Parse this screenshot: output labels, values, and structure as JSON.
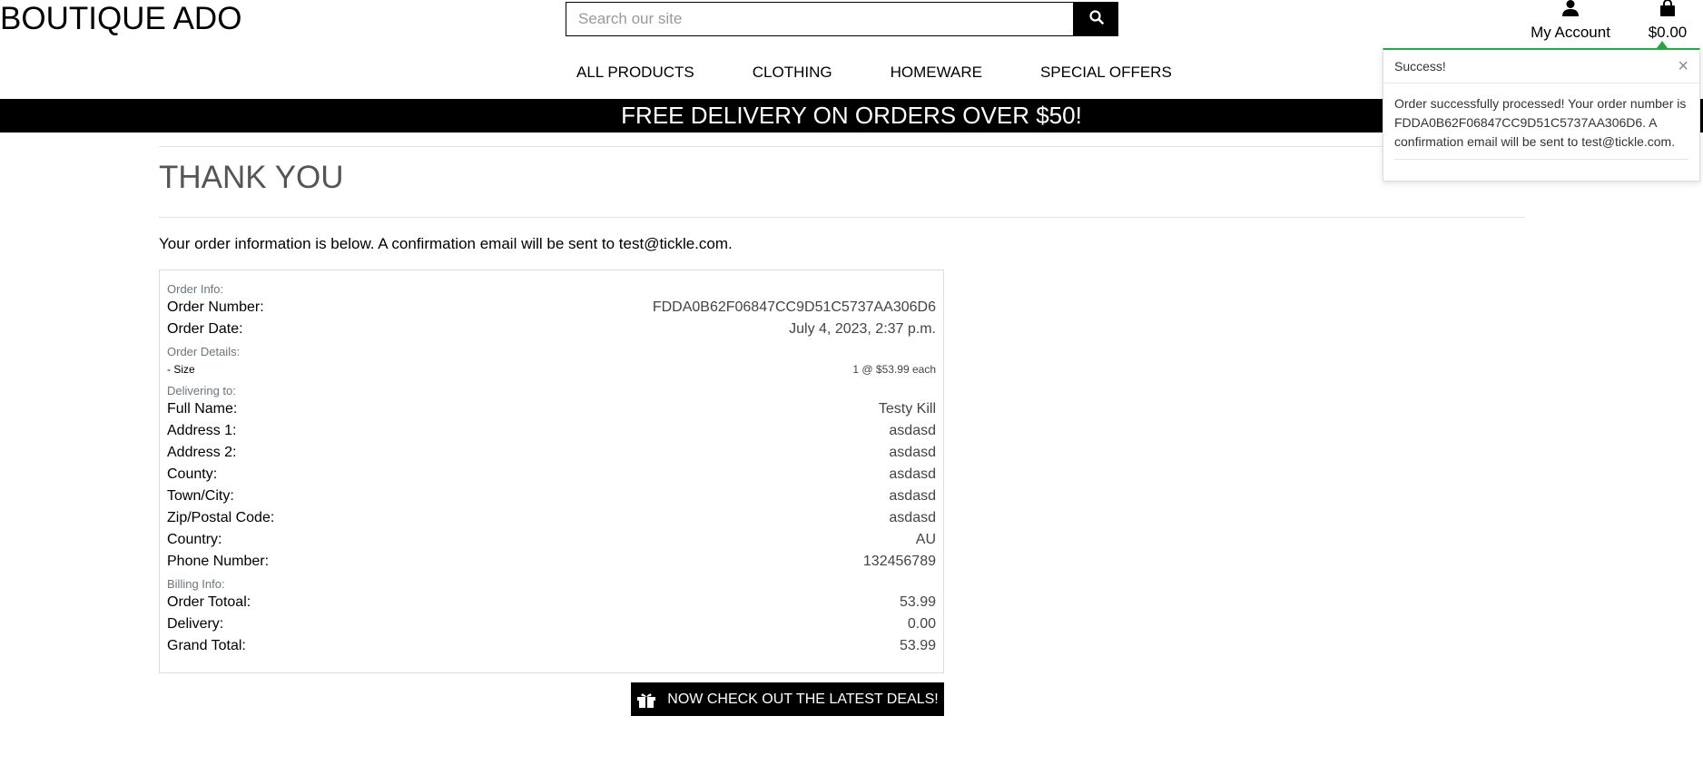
{
  "header": {
    "brand": "BOUTIQUE ADO",
    "search_placeholder": "Search our site",
    "account_label": "My Account",
    "bag_total": "$0.00"
  },
  "nav": {
    "items": [
      "ALL PRODUCTS",
      "CLOTHING",
      "HOMEWARE",
      "SPECIAL OFFERS"
    ]
  },
  "banner": "FREE DELIVERY ON ORDERS OVER $50!",
  "page": {
    "title": "THANK YOU",
    "intro": "Your order information is below. A confirmation email will be sent to test@tickle.com."
  },
  "order": {
    "order_info_heading": "Order Info:",
    "order_number_label": "Order Number:",
    "order_number": "FDDA0B62F06847CC9D51C5737AA306D6",
    "order_date_label": "Order Date:",
    "order_date": "July 4, 2023, 2:37 p.m.",
    "order_details_heading": "Order Details:",
    "item_size_label": "- Size",
    "item_qty": "1 @ $53.99 each",
    "delivering_heading": "Delivering to:",
    "delivery": [
      {
        "label": "Full Name:",
        "value": "Testy Kill"
      },
      {
        "label": "Address 1:",
        "value": "asdasd"
      },
      {
        "label": "Address 2:",
        "value": "asdasd"
      },
      {
        "label": "County:",
        "value": "asdasd"
      },
      {
        "label": "Town/City:",
        "value": "asdasd"
      },
      {
        "label": "Zip/Postal Code:",
        "value": "asdasd"
      },
      {
        "label": "Country:",
        "value": "AU"
      },
      {
        "label": "Phone Number:",
        "value": "132456789"
      }
    ],
    "billing_heading": "Billing Info:",
    "billing": [
      {
        "label": "Order Totoal:",
        "value": "53.99"
      },
      {
        "label": "Delivery:",
        "value": "0.00"
      },
      {
        "label": "Grand Total:",
        "value": "53.99"
      }
    ]
  },
  "deals_button": "NOW CHECK OUT THE LATEST DEALS!",
  "toast": {
    "title": "Success!",
    "close": "×",
    "message": "Order successfully processed! Your order number is FDDA0B62F06847CC9D51C5737AA306D6. A confirmation email will be sent to test@tickle.com."
  },
  "colors": {
    "accent": "#000000",
    "success": "#28a745",
    "muted": "#6c757d"
  },
  "icons": [
    "search-icon",
    "user-icon",
    "shopping-bag-icon",
    "gift-icon",
    "close-icon"
  ]
}
